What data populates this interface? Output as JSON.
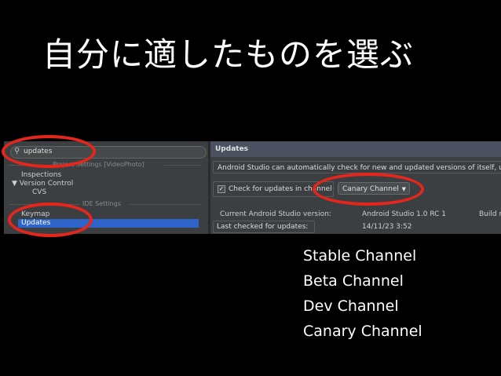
{
  "slide": {
    "title": "自分に適したものを選ぶ"
  },
  "settings": {
    "search_value": "updates",
    "sections": [
      "Project Settings [VideoPhoto]",
      "IDE Settings"
    ],
    "tree": [
      {
        "label": "Inspections"
      },
      {
        "label": "▼ Version Control"
      },
      {
        "label": "CVS"
      },
      {
        "label": "Keymap"
      },
      {
        "label": "Updates"
      }
    ],
    "panel_title": "Updates",
    "description": "Android Studio can automatically check for new and updated versions of itself, us",
    "check_label": "Check for updates in channel",
    "check_mark": "✓",
    "channel_selected": "Canary Channel",
    "current_version_label": "Current Android Studio version:",
    "current_version_value": "Android Studio 1.0 RC 1",
    "build_label": "Build n",
    "last_checked_label": "Last checked for updates:",
    "last_checked_value": "14/11/23 3:52"
  },
  "channels": [
    "Stable Channel",
    "Beta Channel",
    "Dev Channel",
    "Canary Channel"
  ],
  "colors": {
    "annotation": "#e5261d",
    "selection": "#2f65ca",
    "background": "#000000"
  }
}
